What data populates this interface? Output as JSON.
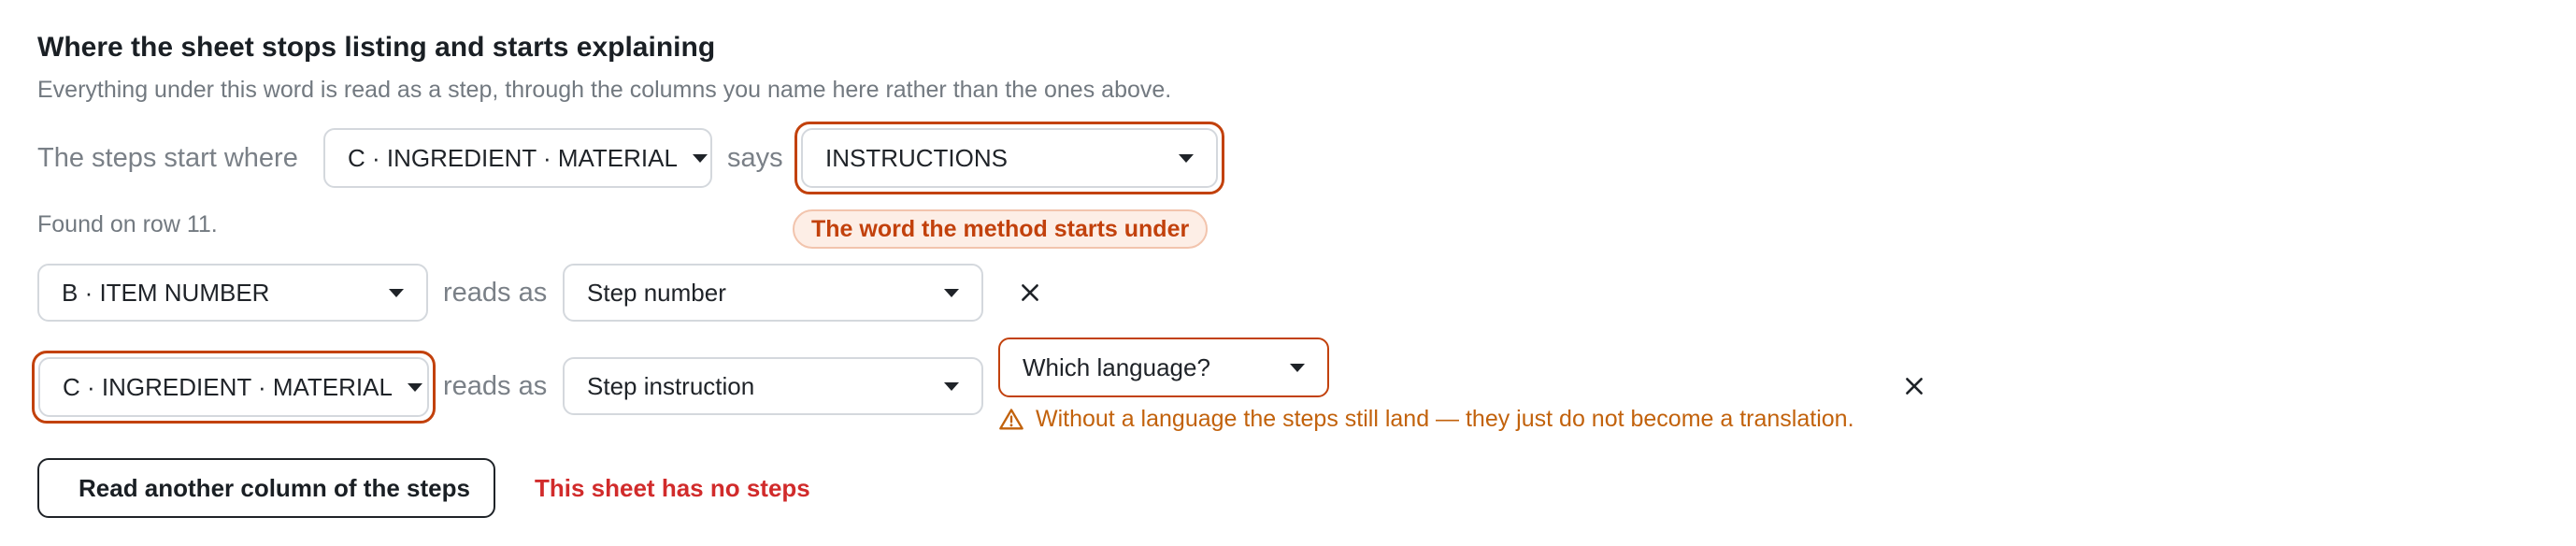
{
  "section": {
    "title": "Where the sheet stops listing and starts explaining",
    "subtitle": "Everything under this word is read as a step, through the columns you name here rather than the ones above."
  },
  "start_row": {
    "prefix": "The steps start where",
    "column_select": "C · INGREDIENT · MATERIAL",
    "says_label": "says",
    "word_select": "INSTRUCTIONS",
    "hint_badge": "The word the method starts under",
    "found_text": "Found on row 11."
  },
  "mappings": [
    {
      "column": "B · ITEM NUMBER",
      "reads_as_label": "reads as",
      "field": "Step number"
    },
    {
      "column": "C · INGREDIENT · MATERIAL",
      "reads_as_label": "reads as",
      "field": "Step instruction",
      "language_select": "Which language?",
      "warning": "Without a language the steps still land — they just do not become a translation."
    }
  ],
  "actions": {
    "add_column": "Read another column of the steps",
    "error": "This sheet has no steps"
  },
  "icons": {
    "caret": "chevron-down-icon",
    "remove": "close-icon",
    "warning": "warning-triangle-icon",
    "add": "plus-icon"
  },
  "colors": {
    "accent_orange": "#c2410c",
    "error_red": "#d12b2b",
    "warning_text": "#c2620c"
  }
}
